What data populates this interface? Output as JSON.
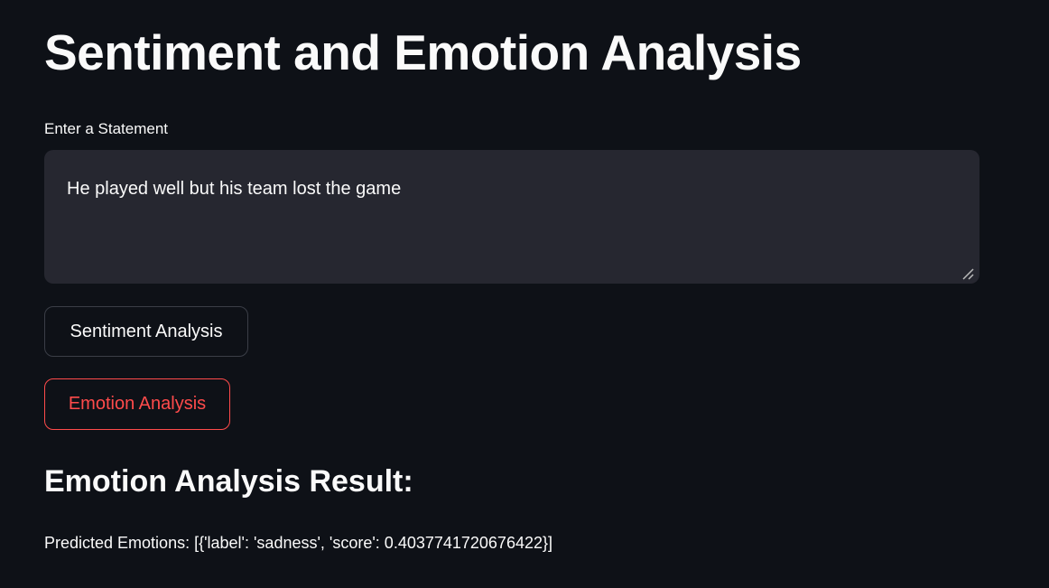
{
  "page": {
    "title": "Sentiment and Emotion Analysis",
    "input": {
      "label": "Enter a Statement",
      "value": "He played well but his team lost the game"
    },
    "buttons": {
      "sentiment": "Sentiment Analysis",
      "emotion": "Emotion Analysis"
    },
    "result": {
      "heading": "Emotion Analysis Result:",
      "text": "Predicted Emotions: [{'label': 'sadness', 'score': 0.4037741720676422}]"
    }
  },
  "colors": {
    "background": "#0e1117",
    "input_background": "#262730",
    "accent": "#ff4b4b"
  }
}
